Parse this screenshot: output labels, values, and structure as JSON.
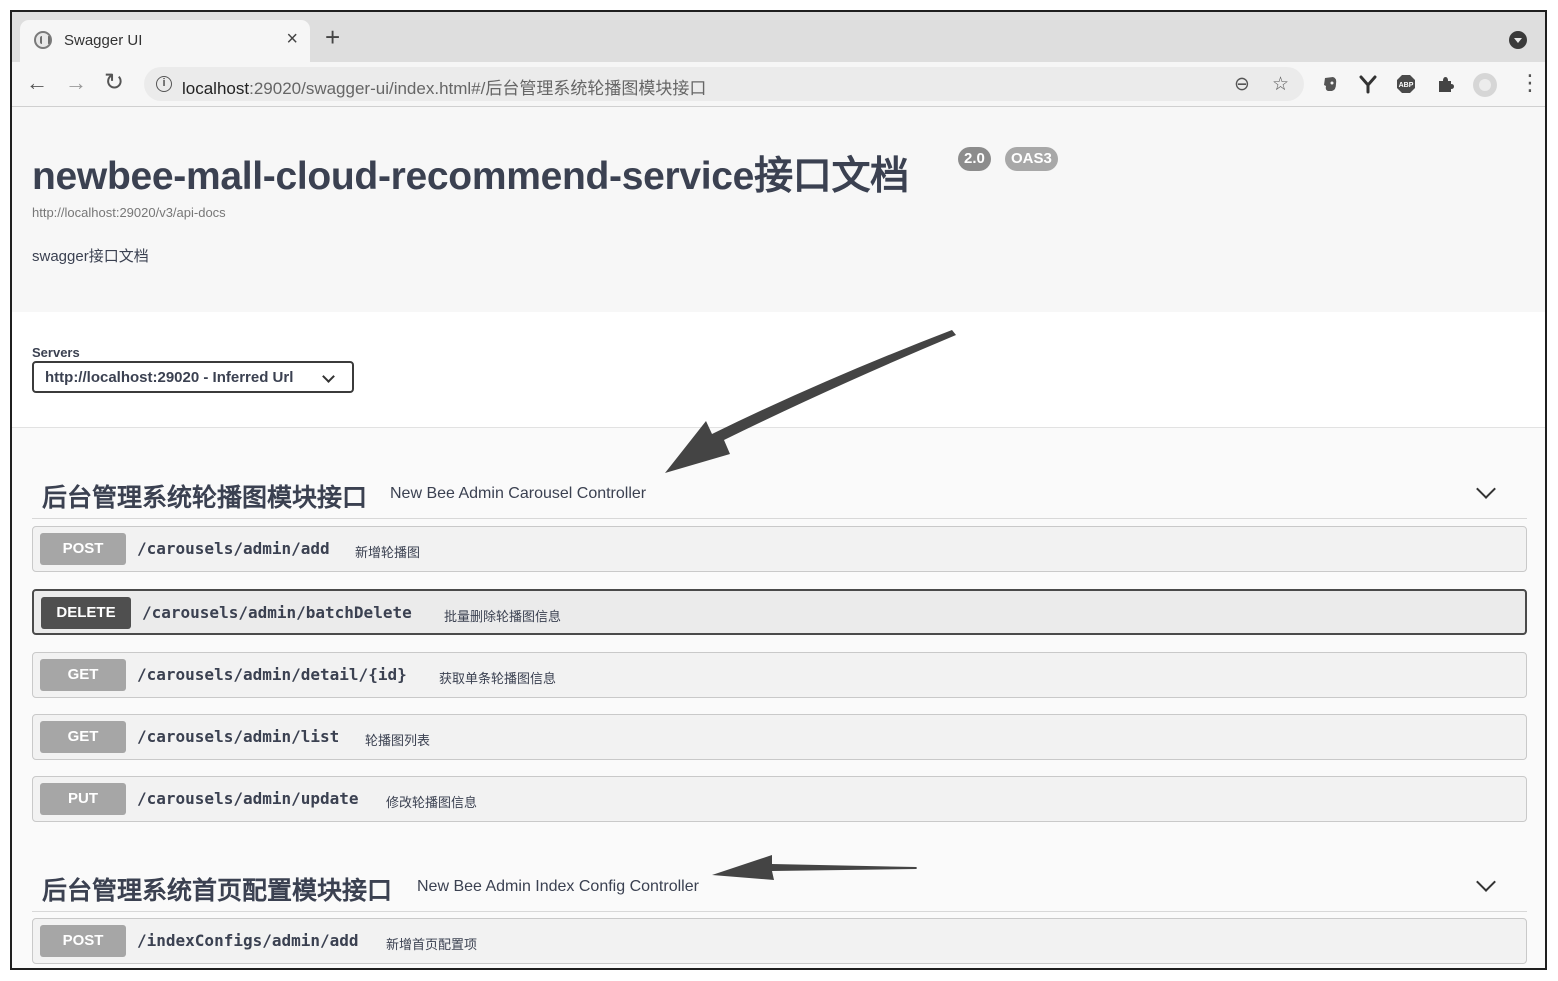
{
  "browser": {
    "tab_title": "Swagger UI",
    "tab_close": "×",
    "new_tab": "+",
    "url_host": "localhost",
    "url_rest": ":29020/swagger-ui/index.html#/后台管理系统轮播图模块接口",
    "back": "←",
    "forward": "→",
    "reload": "↻",
    "info": "i",
    "zoom": "⊖",
    "bookmark": "☆",
    "more": "⋮"
  },
  "info": {
    "title": "newbee-mall-cloud-recommend-service接口文档",
    "version_badge": "2.0",
    "oas_badge": "OAS3",
    "url": "http://localhost:29020/v3/api-docs",
    "description": "swagger接口文档"
  },
  "servers": {
    "label": "Servers",
    "selected": "http://localhost:29020 - Inferred Url"
  },
  "tags": [
    {
      "name": "后台管理系统轮播图模块接口",
      "description": "New Bee Admin Carousel Controller",
      "operations": [
        {
          "method": "POST",
          "path": "/carousels/admin/add",
          "summary": "新增轮播图"
        },
        {
          "method": "DELETE",
          "path": "/carousels/admin/batchDelete",
          "summary": "批量删除轮播图信息"
        },
        {
          "method": "GET",
          "path": "/carousels/admin/detail/{id}",
          "summary": "获取单条轮播图信息"
        },
        {
          "method": "GET",
          "path": "/carousels/admin/list",
          "summary": "轮播图列表"
        },
        {
          "method": "PUT",
          "path": "/carousels/admin/update",
          "summary": "修改轮播图信息"
        }
      ]
    },
    {
      "name": "后台管理系统首页配置模块接口",
      "description": "New Bee Admin Index Config Controller",
      "operations": [
        {
          "method": "POST",
          "path": "/indexConfigs/admin/add",
          "summary": "新增首页配置项"
        }
      ]
    }
  ],
  "colors": {
    "method_badge": "#a6a6a6",
    "delete_badge": "#4f4f4f",
    "annotation_arrow": "#444444"
  }
}
